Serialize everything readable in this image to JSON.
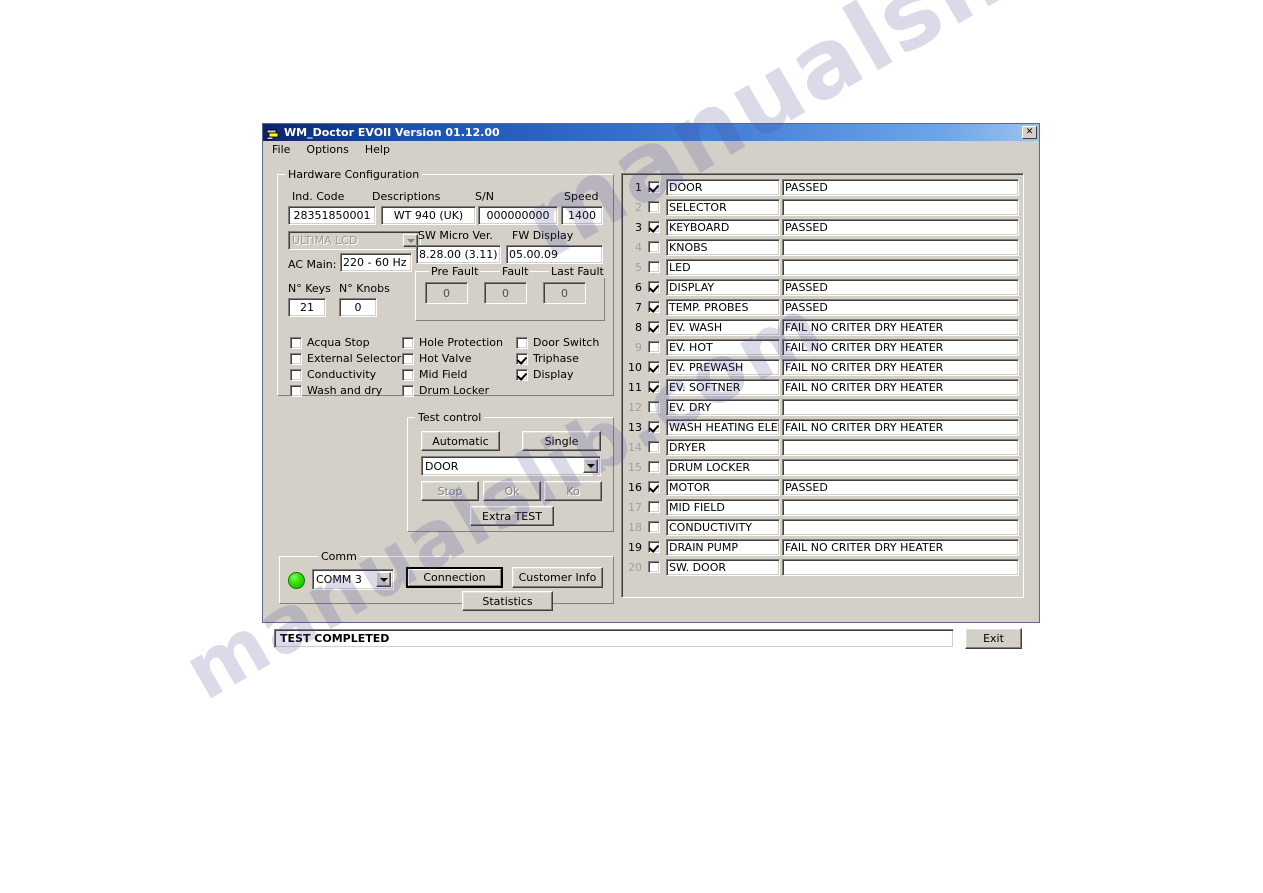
{
  "window": {
    "title": "WM_Doctor EVOII  Version 01.12.00",
    "close_label": "✕",
    "icon": "app-icon"
  },
  "menu": {
    "items": [
      {
        "label": "File"
      },
      {
        "label": "Options"
      },
      {
        "label": "Help"
      }
    ]
  },
  "hardware": {
    "group_title": "Hardware Configuration",
    "labels": {
      "ind_code": "Ind. Code",
      "descriptions": "Descriptions",
      "sn": "S/N",
      "speed": "Speed",
      "sw_micro": "SW Micro Ver.",
      "fw_display": "FW Display",
      "ac_main": "AC Main:",
      "n_keys": "N° Keys",
      "n_knobs": "N° Knobs",
      "pre_fault": "Pre Fault",
      "fault": "Fault",
      "last_fault": "Last Fault"
    },
    "values": {
      "ind_code": "28351850001",
      "descriptions": "WT 940 (UK)",
      "sn": "000000000",
      "speed": "1400",
      "model": "ULTIMA LCD",
      "sw_micro": "8.28.00 (3.11)",
      "fw_display": "05.00.09",
      "ac_main": "220 - 60 Hz",
      "n_keys": "21",
      "n_knobs": "0",
      "pre_fault": "0",
      "fault": "0",
      "last_fault": "0"
    },
    "options": [
      {
        "label": "Acqua Stop",
        "checked": false
      },
      {
        "label": "External Selector",
        "checked": false
      },
      {
        "label": "Conductivity",
        "checked": false
      },
      {
        "label": "Wash and dry",
        "checked": false
      },
      {
        "label": "Hole Protection",
        "checked": false
      },
      {
        "label": "Hot Valve",
        "checked": false
      },
      {
        "label": "Mid Field",
        "checked": false
      },
      {
        "label": "Drum Locker",
        "checked": false
      },
      {
        "label": "Door Switch",
        "checked": false
      },
      {
        "label": "Triphase",
        "checked": true
      },
      {
        "label": "Display",
        "checked": true
      }
    ]
  },
  "test_control": {
    "group_title": "Test control",
    "automatic_label": "Automatic",
    "single_label": "Single",
    "selected_test": "DOOR",
    "stop_label": "Stop",
    "ok_label": "Ok",
    "ko_label": "Ko",
    "extra_test_label": "Extra TEST"
  },
  "comm": {
    "group_title": "Comm",
    "port": "COMM 3",
    "led_color": "#2ee000",
    "connection_label": "Connection",
    "customer_info_label": "Customer Info",
    "statistics_label": "Statistics"
  },
  "results": {
    "rows": [
      {
        "num": "1",
        "checked": true,
        "name": "DOOR",
        "status": "PASSED"
      },
      {
        "num": "2",
        "checked": false,
        "name": "SELECTOR",
        "status": ""
      },
      {
        "num": "3",
        "checked": true,
        "name": "KEYBOARD",
        "status": "PASSED"
      },
      {
        "num": "4",
        "checked": false,
        "name": "KNOBS",
        "status": ""
      },
      {
        "num": "5",
        "checked": false,
        "name": "LED",
        "status": ""
      },
      {
        "num": "6",
        "checked": true,
        "name": "DISPLAY",
        "status": "PASSED"
      },
      {
        "num": "7",
        "checked": true,
        "name": "TEMP. PROBES",
        "status": "PASSED"
      },
      {
        "num": "8",
        "checked": true,
        "name": "EV. WASH",
        "status": "FAIL NO CRITER DRY HEATER"
      },
      {
        "num": "9",
        "checked": false,
        "name": "EV. HOT",
        "status": "FAIL NO CRITER DRY HEATER"
      },
      {
        "num": "10",
        "checked": true,
        "name": "EV. PREWASH",
        "status": "FAIL NO CRITER DRY HEATER"
      },
      {
        "num": "11",
        "checked": true,
        "name": "EV. SOFTNER",
        "status": "FAIL NO CRITER DRY HEATER"
      },
      {
        "num": "12",
        "checked": false,
        "name": "EV. DRY",
        "status": ""
      },
      {
        "num": "13",
        "checked": true,
        "name": "WASH HEATING ELEM",
        "status": "FAIL NO CRITER DRY HEATER"
      },
      {
        "num": "14",
        "checked": false,
        "name": "DRYER",
        "status": ""
      },
      {
        "num": "15",
        "checked": false,
        "name": "DRUM LOCKER",
        "status": ""
      },
      {
        "num": "16",
        "checked": true,
        "name": "MOTOR",
        "status": "PASSED"
      },
      {
        "num": "17",
        "checked": false,
        "name": "MID FIELD",
        "status": ""
      },
      {
        "num": "18",
        "checked": false,
        "name": "CONDUCTIVITY",
        "status": ""
      },
      {
        "num": "19",
        "checked": true,
        "name": "DRAIN PUMP",
        "status": "FAIL NO CRITER DRY HEATER"
      },
      {
        "num": "20",
        "checked": false,
        "name": "SW. DOOR",
        "status": ""
      }
    ]
  },
  "statusbar": {
    "message": "TEST COMPLETED",
    "exit_label": "Exit"
  },
  "watermark": {
    "line1": "manualslib.com",
    "line2": "manualslib.com"
  }
}
